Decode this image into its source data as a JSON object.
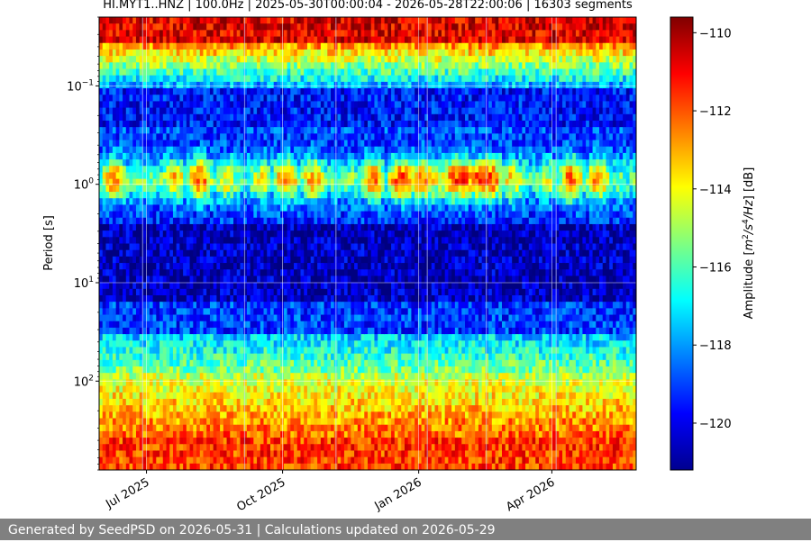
{
  "chart_data": {
    "type": "heatmap",
    "title": "HI.MYT1..HNZ | 100.0Hz | 2025-05-30T00:00:04 - 2026-05-28T22:00:06 | 16303 segments",
    "xlabel": "",
    "ylabel": "Period [s]",
    "xlim": [
      "2025-05-30",
      "2026-05-28"
    ],
    "ylim": [
      0.02,
      800
    ],
    "yscale": "log",
    "y_direction": "inverted",
    "grid": true,
    "x_ticks": [
      {
        "date": "2025-07-01",
        "label": "Jul 2025"
      },
      {
        "date": "2025-10-01",
        "label": "Oct 2025"
      },
      {
        "date": "2026-01-01",
        "label": "Jan 2026"
      },
      {
        "date": "2026-04-01",
        "label": "Apr 2026"
      }
    ],
    "y_ticks": [
      {
        "value": 0.1,
        "base": "10",
        "exp": "−1"
      },
      {
        "value": 1,
        "base": "10",
        "exp": "0"
      },
      {
        "value": 10,
        "base": "10",
        "exp": "1"
      },
      {
        "value": 100,
        "base": "10",
        "exp": "2"
      }
    ],
    "colorbar": {
      "label": "Amplitude [m²/s⁴/Hz] [dB]",
      "colormap": "jet",
      "range": [
        -121.2,
        -109.6
      ],
      "ticks": [
        "−110",
        "−112",
        "−114",
        "−116",
        "−118",
        "−120"
      ],
      "tick_values": [
        -110,
        -112,
        -114,
        -116,
        -118,
        -120
      ]
    },
    "bands": [
      {
        "period_range": [
          0.02,
          0.1
        ],
        "level_db": "-110 to -114"
      },
      {
        "period_range": [
          0.1,
          0.6
        ],
        "level_db": "-119 to -121"
      },
      {
        "period_range": [
          0.6,
          2
        ],
        "level_db": "-112 to -119"
      },
      {
        "period_range": [
          2,
          30
        ],
        "level_db": "-119 to -121"
      },
      {
        "period_range": [
          30,
          100
        ],
        "level_db": "-116 to -118"
      },
      {
        "period_range": [
          100,
          800
        ],
        "level_db": "-110 to -115"
      }
    ]
  },
  "footer": {
    "text": "Generated by SeedPSD on 2026-05-31 | Calculations updated on 2026-05-29"
  }
}
